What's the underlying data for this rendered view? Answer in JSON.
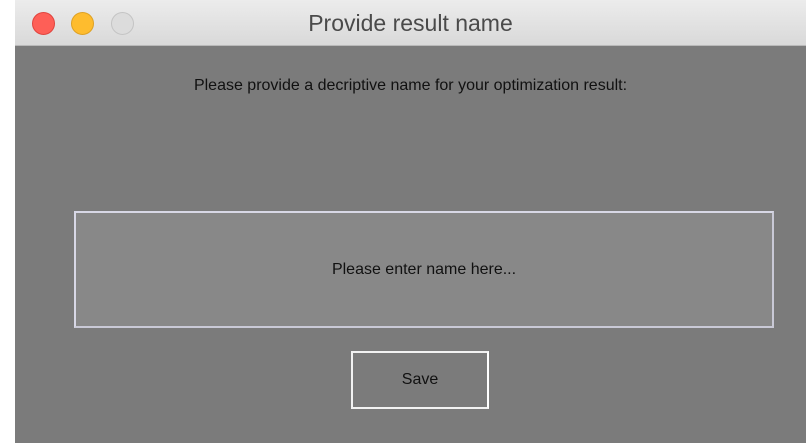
{
  "window": {
    "title": "Provide result name",
    "controls": [
      "close",
      "minimize",
      "zoom"
    ]
  },
  "main": {
    "prompt": "Please provide a decriptive name for your optimization result:",
    "name_input": {
      "value": "",
      "placeholder": "Please enter name here..."
    },
    "save_label": "Save"
  },
  "colors": {
    "background": "#7b7b7b",
    "input_background": "#888888",
    "close": "#fe5f57",
    "minimize": "#febc2e",
    "zoom_disabled": "#dcdcdc"
  }
}
